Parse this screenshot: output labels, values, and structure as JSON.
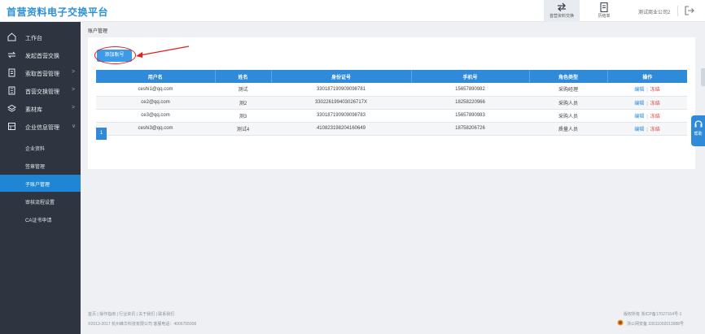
{
  "header": {
    "logo": "首营资料电子交换平台",
    "buttons": [
      {
        "label": "首营资料交换",
        "icon": "swap-arrows-icon"
      },
      {
        "label": "历结单",
        "icon": "document-icon"
      }
    ],
    "company": "测试商业公司2",
    "logout_icon": "logout-icon"
  },
  "sidebar": {
    "items": [
      {
        "label": "工作台",
        "icon": "home-icon",
        "arrow": ""
      },
      {
        "label": "发起首营交换",
        "icon": "exchange-icon",
        "arrow": ""
      },
      {
        "label": "索取首营管理",
        "icon": "request-icon",
        "arrow": ">"
      },
      {
        "label": "首营交换管理",
        "icon": "building-icon",
        "arrow": ">"
      },
      {
        "label": "素材库",
        "icon": "layers-icon",
        "arrow": ">"
      },
      {
        "label": "企业信息管理",
        "icon": "enterprise-icon",
        "arrow": "∨"
      }
    ],
    "subitems": [
      {
        "label": "企业资料"
      },
      {
        "label": "签章管理"
      },
      {
        "label": "子账户管理"
      },
      {
        "label": "审核流程设置"
      },
      {
        "label": "CA证书申请"
      }
    ]
  },
  "main": {
    "title": "账户管理",
    "add_button": "添加账号",
    "table": {
      "headers": [
        "用户名",
        "姓名",
        "身份证号",
        "手机号",
        "角色类型",
        "操作"
      ],
      "rows": [
        {
          "username": "ceshi1@qq.com",
          "name": "测试",
          "id": "330187190909098781",
          "phone": "15657890982",
          "role": "采购经理",
          "edit": "编辑",
          "freeze": "冻结"
        },
        {
          "username": "ce2@qq.com",
          "name": "测2",
          "id": "330226199403026717X",
          "phone": "18258220966",
          "role": "采购人员",
          "edit": "编辑",
          "freeze": "冻结"
        },
        {
          "username": "ce3@qq.com",
          "name": "测3",
          "id": "330187190909098783",
          "phone": "15657890983",
          "role": "采购人员",
          "edit": "编辑",
          "freeze": "冻结"
        },
        {
          "username": "ceshi3@qq.com",
          "name": "测试4",
          "id": "410823198204160649",
          "phone": "18758206726",
          "role": "质量人员",
          "edit": "编辑",
          "freeze": "冻结"
        }
      ]
    },
    "pagination": {
      "current": "1"
    }
  },
  "footer": {
    "links": "首页 | 操作指南 | 行业资讯 | 关于我们 | 联系我们",
    "copyright": "©2013-2017 杭州峰华科技有限公司  客服电话：4006755008",
    "icp": "版权所有 浙ICP备17027164号-1",
    "police": "浙公网安备 33011002013988号"
  },
  "side_help": {
    "label": "帮助",
    "icon": "help-icon"
  },
  "colors": {
    "accent": "#2f8ad9",
    "sidebar": "#2f3540",
    "danger": "#e03b3b",
    "annotation": "#e02020"
  }
}
